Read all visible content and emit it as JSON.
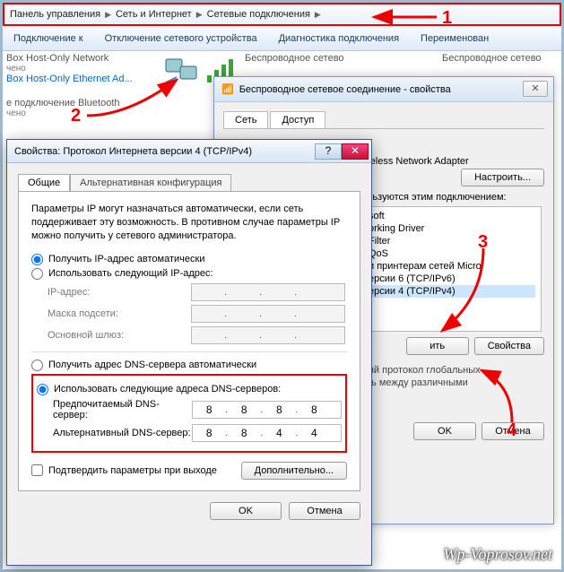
{
  "breadcrumb": {
    "a": "Панель управления",
    "b": "Сеть и Интернет",
    "c": "Сетевые подключения"
  },
  "toolbar": {
    "a": "Подключение к",
    "b": "Отключение сетевого устройства",
    "c": "Диагностика подключения",
    "d": "Переименован"
  },
  "conns": {
    "c1": {
      "t": "Box Host-Only Network",
      "s": "чено",
      "l": "Box Host-Only Ethernet Ad..."
    },
    "c2": {
      "t": "Беспроводное сетево"
    },
    "c3": {
      "t": "Беспроводное сетево"
    },
    "c4": {
      "t": "е подключение Bluetooth",
      "s": "чено"
    }
  },
  "back": {
    "title": "Беспроводное сетевое соединение - свойства",
    "tab1": "Сеть",
    "tab2": "Доступ",
    "adapter": "reless Network Adapter",
    "configure": "Настроить...",
    "uses": "льзуются этим подключением:",
    "items": [
      "soft",
      "orking Driver",
      "Filter",
      "QoS",
      "и принтерам сетей Micro",
      "ерсии 6 (TCP/IPv6)",
      "ерсии 4 (TCP/IPv4)"
    ],
    "install": "ить",
    "props": "Свойства",
    "desc": "ый протокол глобальных\nть между различными\n.",
    "ok": "OK",
    "cancel": "Отмена"
  },
  "front": {
    "title": "Свойства: Протокол Интернета версии 4 (TCP/IPv4)",
    "tab1": "Общие",
    "tab2": "Альтернативная конфигурация",
    "intro": "Параметры IP могут назначаться автоматически, если сеть поддерживает эту возможность. В противном случае параметры IP можно получить у сетевого администратора.",
    "r1": "Получить IP-адрес автоматически",
    "r2": "Использовать следующий IP-адрес:",
    "f_ip": "IP-адрес:",
    "f_mask": "Маска подсети:",
    "f_gw": "Основной шлюз:",
    "r3": "Получить адрес DNS-сервера автоматически",
    "r4": "Использовать следующие адреса DNS-серверов:",
    "f_dns1": "Предпочитаемый DNS-сервер:",
    "f_dns2": "Альтернативный DNS-сервер:",
    "dns1": {
      "a": "8",
      "b": "8",
      "c": "8",
      "d": "8"
    },
    "dns2": {
      "a": "8",
      "b": "8",
      "c": "4",
      "d": "4"
    },
    "chk": "Подтвердить параметры при выходе",
    "adv": "Дополнительно...",
    "ok": "OK",
    "cancel": "Отмена"
  },
  "ann": {
    "n1": "1",
    "n2": "2",
    "n3": "3",
    "n4": "4"
  },
  "watermark": "Wp-Voprosov.net"
}
